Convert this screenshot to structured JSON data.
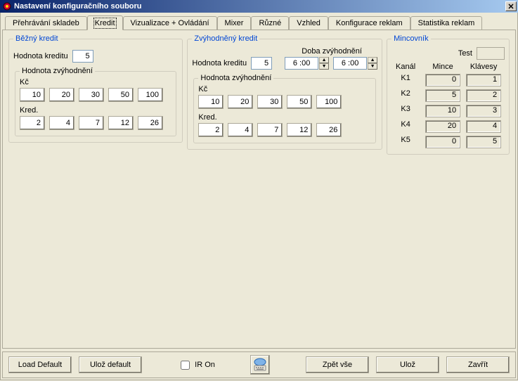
{
  "window": {
    "title": "Nastavení konfiguračního souboru"
  },
  "tabs": [
    {
      "label": "Přehrávání skladeb"
    },
    {
      "label": "Kredit"
    },
    {
      "label": "Vizualizace + Ovládání"
    },
    {
      "label": "Mixer"
    },
    {
      "label": "Různé"
    },
    {
      "label": "Vzhled"
    },
    {
      "label": "Konfigurace reklam"
    },
    {
      "label": "Statistika reklam"
    }
  ],
  "normal": {
    "title": "Běžný kredit",
    "value_label": "Hodnota kreditu",
    "value": "5",
    "bonus_title": "Hodnota zvýhodnění",
    "kc_label": "Kč",
    "kc": [
      "10",
      "20",
      "30",
      "50",
      "100"
    ],
    "kred_label": "Kred.",
    "kred": [
      "2",
      "4",
      "7",
      "12",
      "26"
    ]
  },
  "discount": {
    "title": "Zvýhodněný kredit",
    "value_label": "Hodnota kreditu",
    "value": "5",
    "time_title": "Doba zvýhodnění",
    "time_from": "6 :00",
    "time_to": "6 :00",
    "bonus_title": "Hodnota zvýhodnění",
    "kc_label": "Kč",
    "kc": [
      "10",
      "20",
      "30",
      "50",
      "100"
    ],
    "kred_label": "Kred.",
    "kred": [
      "2",
      "4",
      "7",
      "12",
      "26"
    ]
  },
  "coin": {
    "title": "Mincovník",
    "test_label": "Test",
    "test_value": "",
    "headers": {
      "kanal": "Kanál",
      "mince": "Mince",
      "klavesy": "Klávesy"
    },
    "rows": [
      {
        "ch": "K1",
        "mince": "0",
        "klavesy": "1"
      },
      {
        "ch": "K2",
        "mince": "5",
        "klavesy": "2"
      },
      {
        "ch": "K3",
        "mince": "10",
        "klavesy": "3"
      },
      {
        "ch": "K4",
        "mince": "20",
        "klavesy": "4"
      },
      {
        "ch": "K5",
        "mince": "0",
        "klavesy": "5"
      }
    ]
  },
  "bottom": {
    "load_default": "Load Default",
    "save_default": "Ulož default",
    "ir_on": "IR On",
    "revert": "Zpět vše",
    "save": "Ulož",
    "close": "Zavřít"
  }
}
